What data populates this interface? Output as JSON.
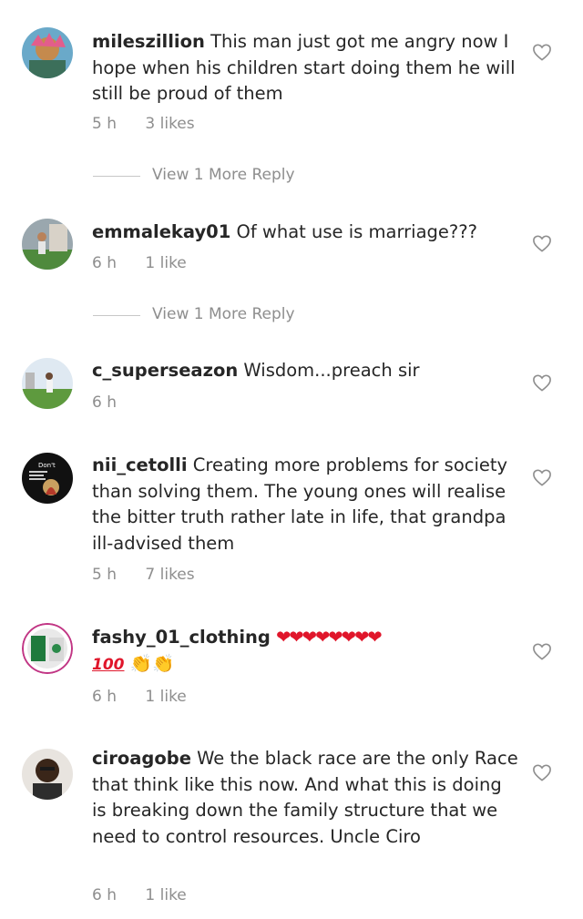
{
  "comments": [
    {
      "username": "mileszillion",
      "text": "This man just got me angry now I hope when his children start doing them he will still be proud of them",
      "time": "5 h",
      "likes": "3 likes",
      "replies": "View 1 More Reply"
    },
    {
      "username": "emmalekay01",
      "text": "Of what use is marriage???",
      "time": "6 h",
      "likes": "1 like",
      "replies": "View 1 More Reply"
    },
    {
      "username": "c_superseazon",
      "text": "Wisdom...preach sir",
      "time": "6 h",
      "likes": ""
    },
    {
      "username": "nii_cetolli",
      "text": "Creating more problems for society than solving them. The young ones will realise the bitter truth rather late in life, that grandpa ill-advised them",
      "time": "5 h",
      "likes": "7 likes",
      "avatar_text": "Don't"
    },
    {
      "username": "fashy_01_clothing",
      "emoji_hearts": "❤❤❤❤❤❤❤❤",
      "emoji_100": "100",
      "emoji_claps": "👏👏",
      "time": "6 h",
      "likes": "1 like"
    },
    {
      "username": "ciroagobe",
      "text": "We the black race are the only Race that think like this now. And what this is doing is breaking down the family structure that we need to control resources. Uncle Ciro",
      "time": "6 h",
      "likes": "1 like"
    }
  ],
  "colors": {
    "text": "#262626",
    "meta": "#8e8e8e",
    "heart_emoji": "#e0162b"
  },
  "icons": {
    "like": "heart-outline-icon"
  }
}
